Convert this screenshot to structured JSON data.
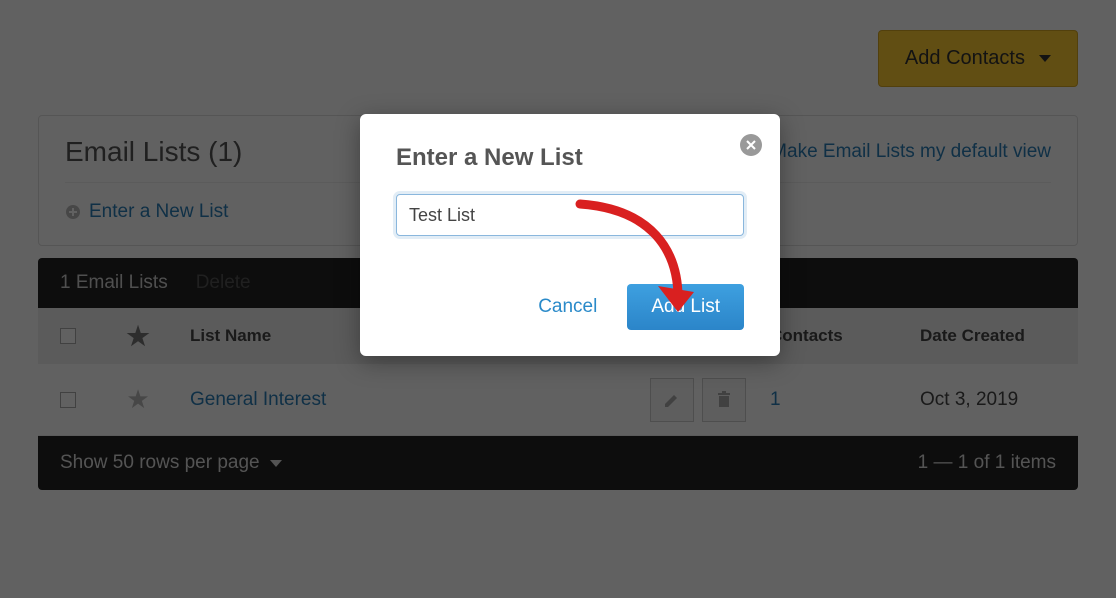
{
  "header": {
    "add_contacts_label": "Add Contacts"
  },
  "panel": {
    "title": "Email Lists (1)",
    "default_view_link": "Make Email Lists my default view",
    "new_list_link": "Enter a New List"
  },
  "toolbar": {
    "count_label": "1 Email Lists",
    "delete_label": "Delete"
  },
  "table": {
    "columns": {
      "name": "List Name",
      "contacts": "Contacts",
      "date": "Date Created"
    },
    "rows": [
      {
        "name": "General Interest",
        "contacts": "1",
        "date": "Oct 3, 2019"
      }
    ]
  },
  "footer": {
    "rows_per_page": "Show 50 rows per page",
    "range_label": "1 — 1 of 1 items"
  },
  "modal": {
    "title": "Enter a New List",
    "input_value": "Test List",
    "cancel_label": "Cancel",
    "submit_label": "Add List"
  }
}
